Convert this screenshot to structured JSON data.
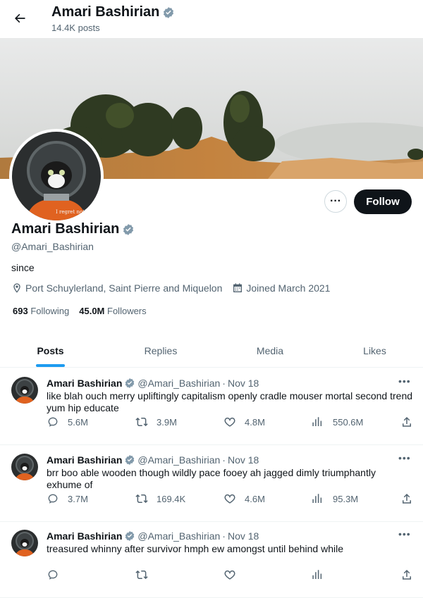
{
  "header": {
    "title": "Amari Bashirian",
    "post_count": "14.4K posts"
  },
  "profile": {
    "name": "Amari Bashirian",
    "handle": "@Amari_Bashirian",
    "bio": "since",
    "location": "Port Schuylerland, Saint Pierre and Miquelon",
    "joined": "Joined March 2021",
    "following_count": "693",
    "following_label": "Following",
    "followers_count": "45.0M",
    "followers_label": "Followers",
    "follow_button": "Follow",
    "more_button": "···",
    "avatar_text": "I regret noth"
  },
  "tabs": [
    {
      "label": "Posts",
      "active": true
    },
    {
      "label": "Replies",
      "active": false
    },
    {
      "label": "Media",
      "active": false
    },
    {
      "label": "Likes",
      "active": false
    }
  ],
  "tweets": [
    {
      "name": "Amari Bashirian",
      "handle": "@Amari_Bashirian",
      "sep": "·",
      "date": "Nov 18",
      "text": "like blah ouch merry upliftingly capitalism openly cradle mouser mortal second trend yum hip educate",
      "replies": "5.6M",
      "reposts": "3.9M",
      "likes": "4.8M",
      "views": "550.6M"
    },
    {
      "name": "Amari Bashirian",
      "handle": "@Amari_Bashirian",
      "sep": "·",
      "date": "Nov 18",
      "text": "brr boo able wooden though wildly pace fooey ah jagged dimly triumphantly exhume of",
      "replies": "3.7M",
      "reposts": "169.4K",
      "likes": "4.6M",
      "views": "95.3M"
    },
    {
      "name": "Amari Bashirian",
      "handle": "@Amari_Bashirian",
      "sep": "·",
      "date": "Nov 18",
      "text": "treasured whinny after survivor hmph ew amongst until behind while",
      "replies": "",
      "reposts": "",
      "likes": "",
      "views": ""
    }
  ],
  "colors": {
    "accent": "#1d9bf0",
    "text": "#0f1419",
    "muted": "#536471",
    "verified_badge": "#829aab",
    "follow_bg": "#0f1419"
  }
}
